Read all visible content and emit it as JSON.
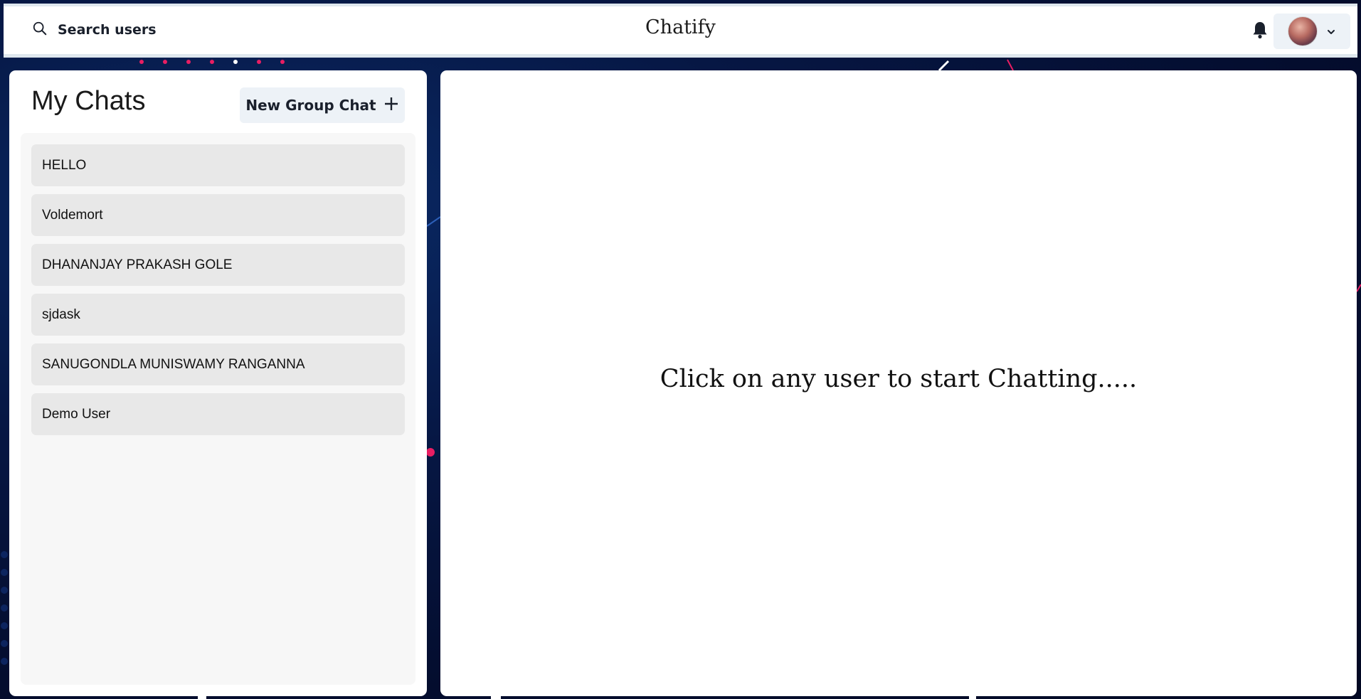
{
  "header": {
    "search_label": "Search users",
    "brand": "Chatify",
    "icons": {
      "search": "search-icon",
      "bell": "bell-icon",
      "chevron": "chevron-down-icon"
    }
  },
  "left": {
    "title": "My Chats",
    "new_group_label": "New Group Chat",
    "chats": [
      {
        "name": "HELLO"
      },
      {
        "name": "Voldemort"
      },
      {
        "name": "DHANANJAY PRAKASH GOLE"
      },
      {
        "name": "sjdask"
      },
      {
        "name": "SANUGONDLA MUNISWAMY RANGANNA"
      },
      {
        "name": "Demo User"
      }
    ]
  },
  "main": {
    "placeholder": "Click on any user to start Chatting....."
  },
  "colors": {
    "accent_pink": "#e91e63",
    "background_navy": "#061744",
    "button_bg": "#edf2f7",
    "chat_item_bg": "#e8e8e8"
  }
}
